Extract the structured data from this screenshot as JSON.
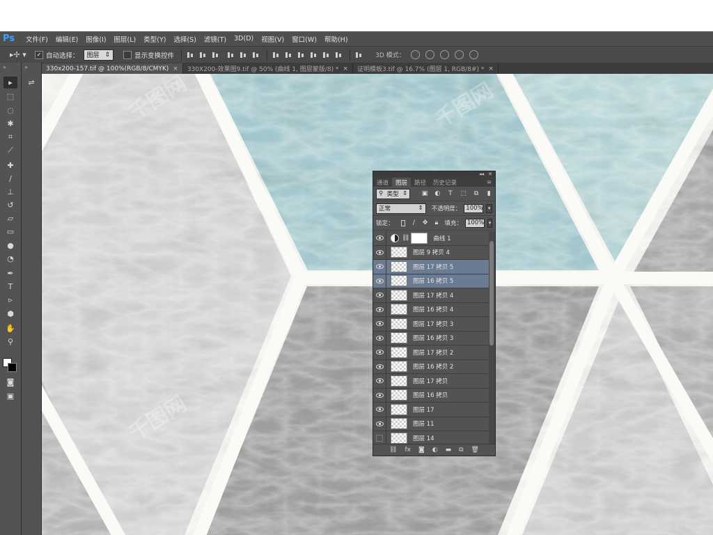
{
  "app": {
    "logo": "Ps",
    "menu": [
      "文件(F)",
      "编辑(E)",
      "图像(I)",
      "图层(L)",
      "类型(Y)",
      "选择(S)",
      "滤镜(T)",
      "3D(D)",
      "视图(V)",
      "窗口(W)",
      "帮助(H)"
    ]
  },
  "options_bar": {
    "auto_select_label": "自动选择：",
    "auto_select_value": "图层",
    "show_transform_label": "显示变换控件",
    "mode_3d_label": "3D 模式："
  },
  "tabs": [
    {
      "label": "330x200-157.tif @ 100%(RGB/8/CMYK)",
      "active": true
    },
    {
      "label": "330X200-效果图9.tif @ 50% (曲线 1, 图层蒙版/8) *",
      "active": false
    },
    {
      "label": "证明模板3.tif @ 16.7% (图层 1, RGB/8#) *",
      "active": false
    }
  ],
  "tools": [
    "move-tool",
    "marquee-tool",
    "lasso-tool",
    "magic-wand-tool",
    "crop-tool",
    "eyedropper-tool",
    "healing-tool",
    "brush-tool",
    "stamp-tool",
    "history-brush-tool",
    "eraser-tool",
    "gradient-tool",
    "blur-tool",
    "dodge-tool",
    "pen-tool",
    "type-tool",
    "path-select-tool",
    "shape-tool",
    "hand-tool",
    "zoom-tool"
  ],
  "layers_panel": {
    "tabs": [
      {
        "label": "通道",
        "active": false
      },
      {
        "label": "图层",
        "active": true
      },
      {
        "label": "路径",
        "active": false
      },
      {
        "label": "历史记录",
        "active": false
      }
    ],
    "filter_kind": "类型",
    "blend_mode": "正常",
    "opacity_label": "不透明度：",
    "opacity_value": "100%",
    "lock_label": "锁定：",
    "fill_label": "填充：",
    "fill_value": "100%",
    "layers": [
      {
        "name": "曲线 1",
        "type": "adjustment",
        "visible": true,
        "selected": false
      },
      {
        "name": "图层 9 拷贝 4",
        "type": "pixel",
        "visible": true,
        "selected": false
      },
      {
        "name": "图层 17 拷贝 5",
        "type": "pixel",
        "visible": true,
        "selected": true
      },
      {
        "name": "图层 16 拷贝 5",
        "type": "pixel",
        "visible": true,
        "selected": true
      },
      {
        "name": "图层 17 拷贝 4",
        "type": "pixel",
        "visible": true,
        "selected": false
      },
      {
        "name": "图层 16 拷贝 4",
        "type": "pixel",
        "visible": true,
        "selected": false
      },
      {
        "name": "图层 17 拷贝 3",
        "type": "pixel",
        "visible": true,
        "selected": false
      },
      {
        "name": "图层 16 拷贝 3",
        "type": "pixel",
        "visible": true,
        "selected": false
      },
      {
        "name": "图层 17 拷贝 2",
        "type": "pixel",
        "visible": true,
        "selected": false
      },
      {
        "name": "图层 16 拷贝 2",
        "type": "pixel",
        "visible": true,
        "selected": false
      },
      {
        "name": "图层 17 拷贝",
        "type": "pixel",
        "visible": true,
        "selected": false
      },
      {
        "name": "图层 16 拷贝",
        "type": "pixel",
        "visible": true,
        "selected": false
      },
      {
        "name": "图层 17",
        "type": "pixel",
        "visible": true,
        "selected": false
      },
      {
        "name": "图层 11",
        "type": "pixel",
        "visible": true,
        "selected": false
      },
      {
        "name": "图层 14",
        "type": "pixel",
        "visible": false,
        "selected": false
      }
    ]
  },
  "colors": {
    "ui_dark": "#535353",
    "selection": "#6b7b91",
    "marble_teal": "#9fc9cf",
    "marble_gray": "#9a9a9a",
    "marble_light": "#d8d8d8",
    "grout": "#fafaf6"
  }
}
